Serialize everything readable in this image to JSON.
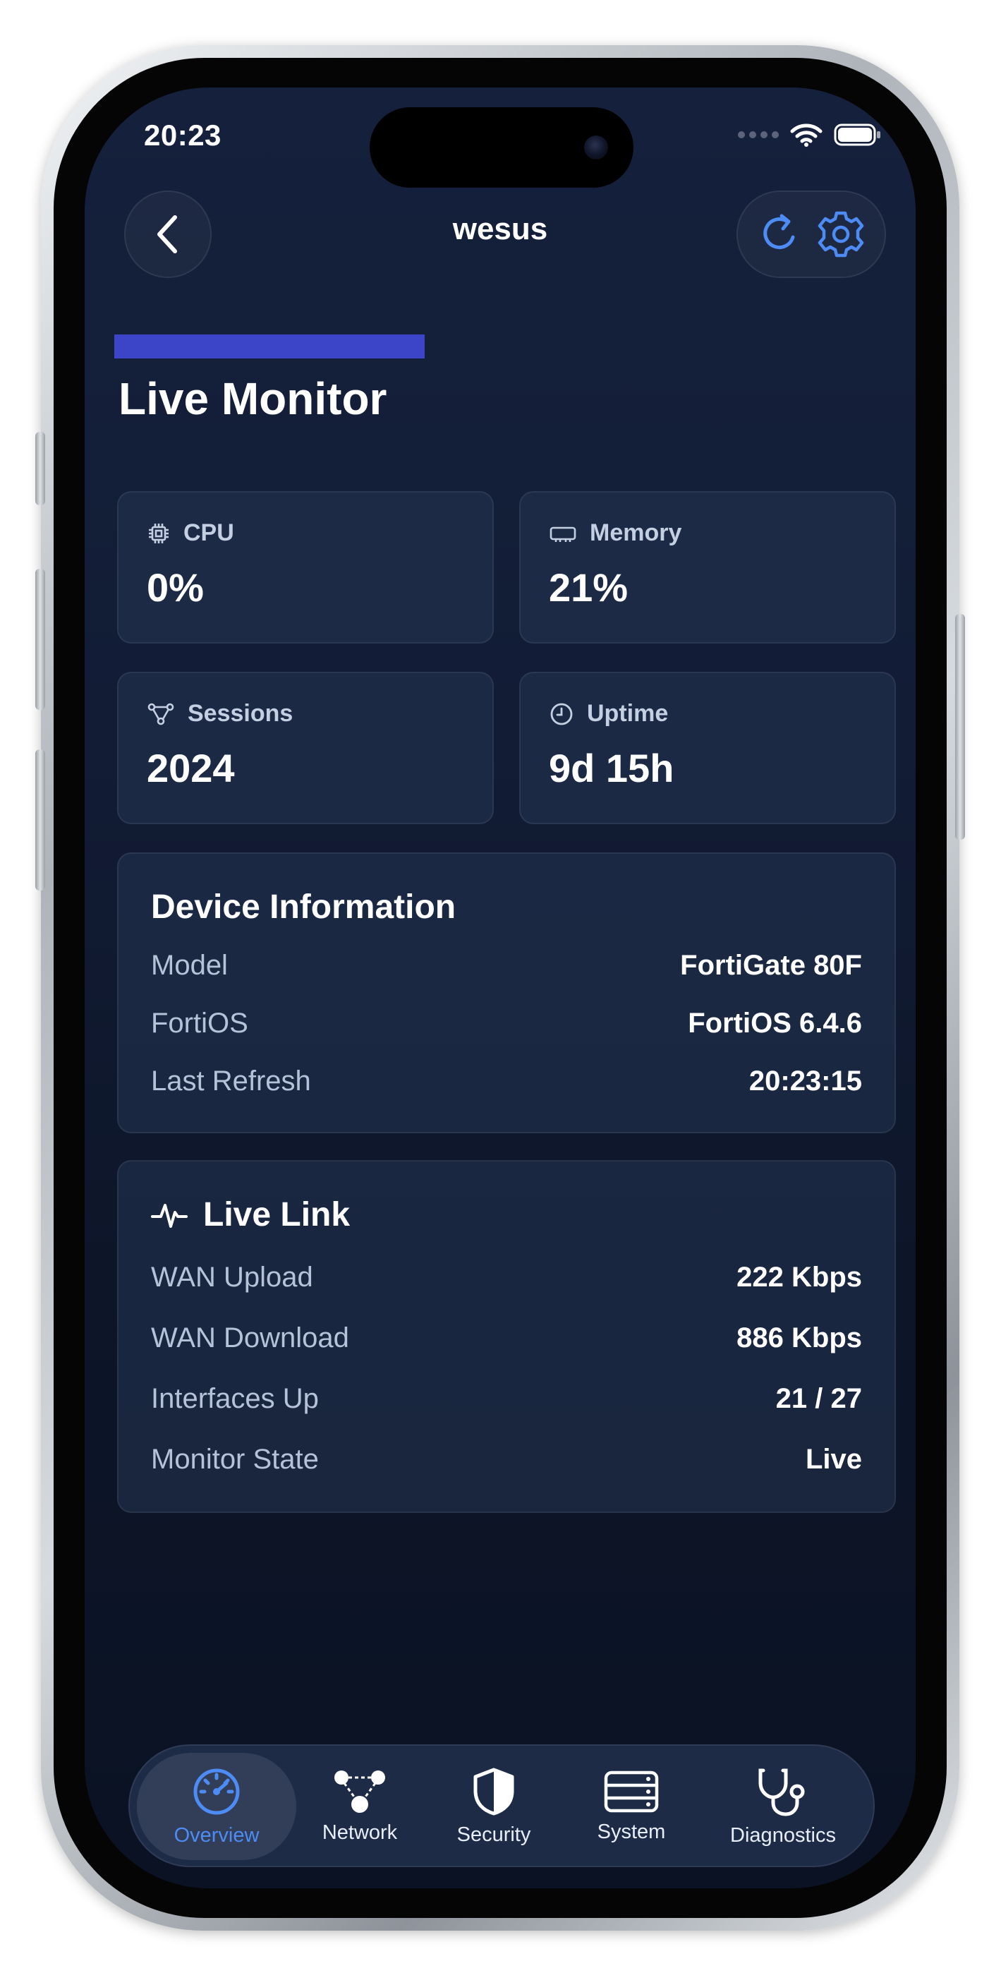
{
  "status_bar": {
    "time": "20:23"
  },
  "nav": {
    "title": "wesus"
  },
  "page": {
    "title": "Live Monitor"
  },
  "stats": {
    "cpu": {
      "label": "CPU",
      "value": "0%"
    },
    "memory": {
      "label": "Memory",
      "value": "21%"
    },
    "sessions": {
      "label": "Sessions",
      "value": "2024"
    },
    "uptime": {
      "label": "Uptime",
      "value": "9d 15h"
    }
  },
  "device_info": {
    "title": "Device Information",
    "rows": [
      {
        "label": "Model",
        "value": "FortiGate 80F"
      },
      {
        "label": "FortiOS",
        "value": "FortiOS 6.4.6"
      },
      {
        "label": "Last Refresh",
        "value": "20:23:15"
      }
    ]
  },
  "live_link": {
    "title": "Live Link",
    "rows": [
      {
        "label": "WAN Upload",
        "value": "222 Kbps"
      },
      {
        "label": "WAN Download",
        "value": "886 Kbps"
      },
      {
        "label": "Interfaces Up",
        "value": "21 / 27"
      },
      {
        "label": "Monitor State",
        "value": "Live"
      }
    ]
  },
  "tabs": [
    {
      "label": "Overview",
      "icon": "gauge-icon",
      "active": true
    },
    {
      "label": "Network",
      "icon": "network-icon",
      "active": false
    },
    {
      "label": "Security",
      "icon": "shield-icon",
      "active": false
    },
    {
      "label": "System",
      "icon": "server-icon",
      "active": false
    },
    {
      "label": "Diagnostics",
      "icon": "stethoscope-icon",
      "active": false
    }
  ],
  "colors": {
    "accent": "#4d8bf5",
    "background": "#121c35",
    "card": "#1e2c48",
    "redaction": "#3c44c8"
  }
}
